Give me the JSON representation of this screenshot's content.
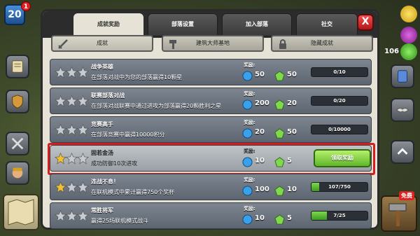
{
  "hud": {
    "level": "20",
    "level_notifications": "1",
    "resource_value": "106",
    "free_label": "免费"
  },
  "tabs": [
    {
      "label": "成就奖励",
      "active": true
    },
    {
      "label": "部落设置",
      "active": false
    },
    {
      "label": "加入部落",
      "active": false
    },
    {
      "label": "社交",
      "active": false
    }
  ],
  "close_label": "X",
  "subtabs": [
    {
      "label": "成就",
      "icon": "sword-icon",
      "active": true
    },
    {
      "label": "建筑大师基地",
      "icon": "hammer-icon",
      "active": false
    },
    {
      "label": "隐藏成就",
      "icon": "lock-icon",
      "active": false
    }
  ],
  "reward_label": "奖励:",
  "achievements": [
    {
      "title": "战争英雄",
      "desc": "在部落对战中为您的部落赢得10颗星",
      "stars": 0,
      "elixir": "50",
      "gems": "50",
      "progress_text": "0/10",
      "progress": 0.0,
      "highlight": false
    },
    {
      "title": "联赛部落对战",
      "desc": "在部落对战联赛中通过进攻为部落赢得20颗胜利之星",
      "stars": 0,
      "elixir": "200",
      "gems": "20",
      "progress_text": "0/20",
      "progress": 0.0,
      "highlight": false
    },
    {
      "title": "竞赛高手",
      "desc": "在部落竞赛中赢得10000积分",
      "stars": 0,
      "elixir": "20",
      "gems": "50",
      "progress_text": "0/10000",
      "progress": 0.0,
      "highlight": false
    },
    {
      "title": "固若金汤",
      "desc": "成功防御10次进攻",
      "stars": 1,
      "elixir": "10",
      "gems": "5",
      "progress_text": "",
      "progress": 1.0,
      "highlight": true,
      "claim_label": "领取奖励"
    },
    {
      "title": "连战不息！",
      "desc": "在联机模式中累计赢得750个奖杯",
      "stars": 1,
      "elixir": "100",
      "gems": "10",
      "progress_text": "107/750",
      "progress": 0.143,
      "highlight": false
    },
    {
      "title": "常胜将军",
      "desc": "赢得25场联机模式战斗",
      "stars": 0,
      "elixir": "10",
      "gems": "5",
      "progress_text": "7/25",
      "progress": 0.28,
      "highlight": false
    }
  ],
  "colors": {
    "highlight_border": "#d71e1e",
    "progress_fill": "#5fb62a",
    "claim_button": "#7fd850"
  }
}
